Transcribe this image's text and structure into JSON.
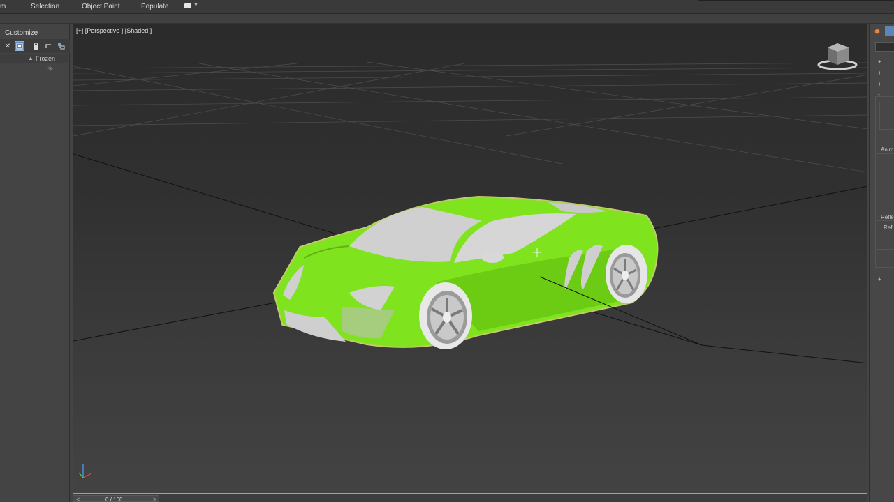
{
  "ribbon": {
    "tabs": [
      "m",
      "Selection",
      "Object Paint",
      "Populate"
    ],
    "extra_icon": "view-toggle-icon"
  },
  "explorer": {
    "title": "Customize",
    "toolbar_icons": [
      "close-icon",
      "display-filter-icon",
      "lock-icon",
      "hierarchy-icon",
      "layer-icon"
    ],
    "column_header": "Frozen",
    "freeze_icon": "snowflake-icon"
  },
  "viewport": {
    "label": "[+] [Perspective ] [Shaded ]",
    "selection_color": "#b9a654",
    "car_color": "#7fe31d",
    "viewcube_icon": "viewcube-icon",
    "axis_icon": "axis-tripod-icon"
  },
  "timeline": {
    "frames": "0 / 100",
    "prev": "<",
    "next": ">"
  },
  "command_panel": {
    "labels": [
      "Anim",
      "Refle",
      "Ref"
    ],
    "rollout_marks": [
      "+",
      "+",
      "+",
      "-",
      "+"
    ]
  }
}
